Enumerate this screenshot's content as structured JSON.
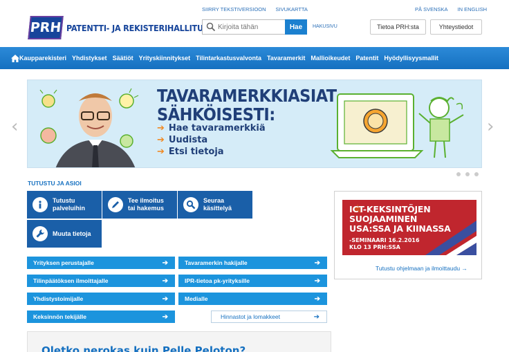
{
  "header": {
    "logo_mark": "PRH",
    "logo_text": "PATENTTI- JA REKISTERIHALLITUS",
    "top_links_left": [
      "SIIRRY TEKSTIVERSIOON",
      "SIVUKARTTA"
    ],
    "top_links_right": [
      "PÅ SVENSKA",
      "IN ENGLISH"
    ],
    "search": {
      "placeholder": "Kirjoita tähän",
      "button": "Hae",
      "advanced": "HAKUSIVU"
    },
    "buttons": [
      "Tietoa PRH:sta",
      "Yhteystiedot"
    ]
  },
  "nav": {
    "items": [
      "Kaupparekisteri",
      "Yhdistykset",
      "Säätiöt",
      "Yrityskiinnitykset",
      "Tilintarkastusvalvonta",
      "Tavaramerkit",
      "Mallioikeudet",
      "Patentit",
      "Hyödyllisyysmallit"
    ]
  },
  "banner": {
    "title_line1": "TAVARAMERKKIASIAT",
    "title_line2": "SÄHKÖISESTI:",
    "items": [
      "Hae tavaramerkkiä",
      "Uudista",
      "Etsi tietoja"
    ]
  },
  "section": {
    "label": "TUTUSTU JA ASIOI",
    "tiles": [
      {
        "l1": "Tutustu",
        "l2": "palveluihin"
      },
      {
        "l1": "Tee ilmoitus",
        "l2": "tai hakemus"
      },
      {
        "l1": "Seuraa",
        "l2": "käsittelyä"
      },
      {
        "l1": "Muuta tietoja",
        "l2": ""
      }
    ],
    "bars_left": [
      "Yrityksen perustajalle",
      "Tilinpäätöksen ilmoittajalle",
      "Yhdistystoimijalle",
      "Keksinnön tekijälle"
    ],
    "bars_right": [
      "Tavaramerkin hakijalle",
      "IPR-tietoa pk-yrityksille",
      "Medialle"
    ],
    "bar_light": "Hinnastot ja lomakkeet"
  },
  "promo": {
    "lines": [
      "ICT-KEKSINTÖJEN",
      "SUOJAAMINEN",
      "USA:SSA JA KIINASSA"
    ],
    "sub1": "-SEMINAARI 16.2.2016",
    "sub2": "KLO 13 PRH:SSA",
    "link": "Tutustu ohjelmaan ja ilmoittaudu →"
  },
  "bottom": {
    "heading": "Oletko nerokas kuin Pelle Peloton?"
  }
}
